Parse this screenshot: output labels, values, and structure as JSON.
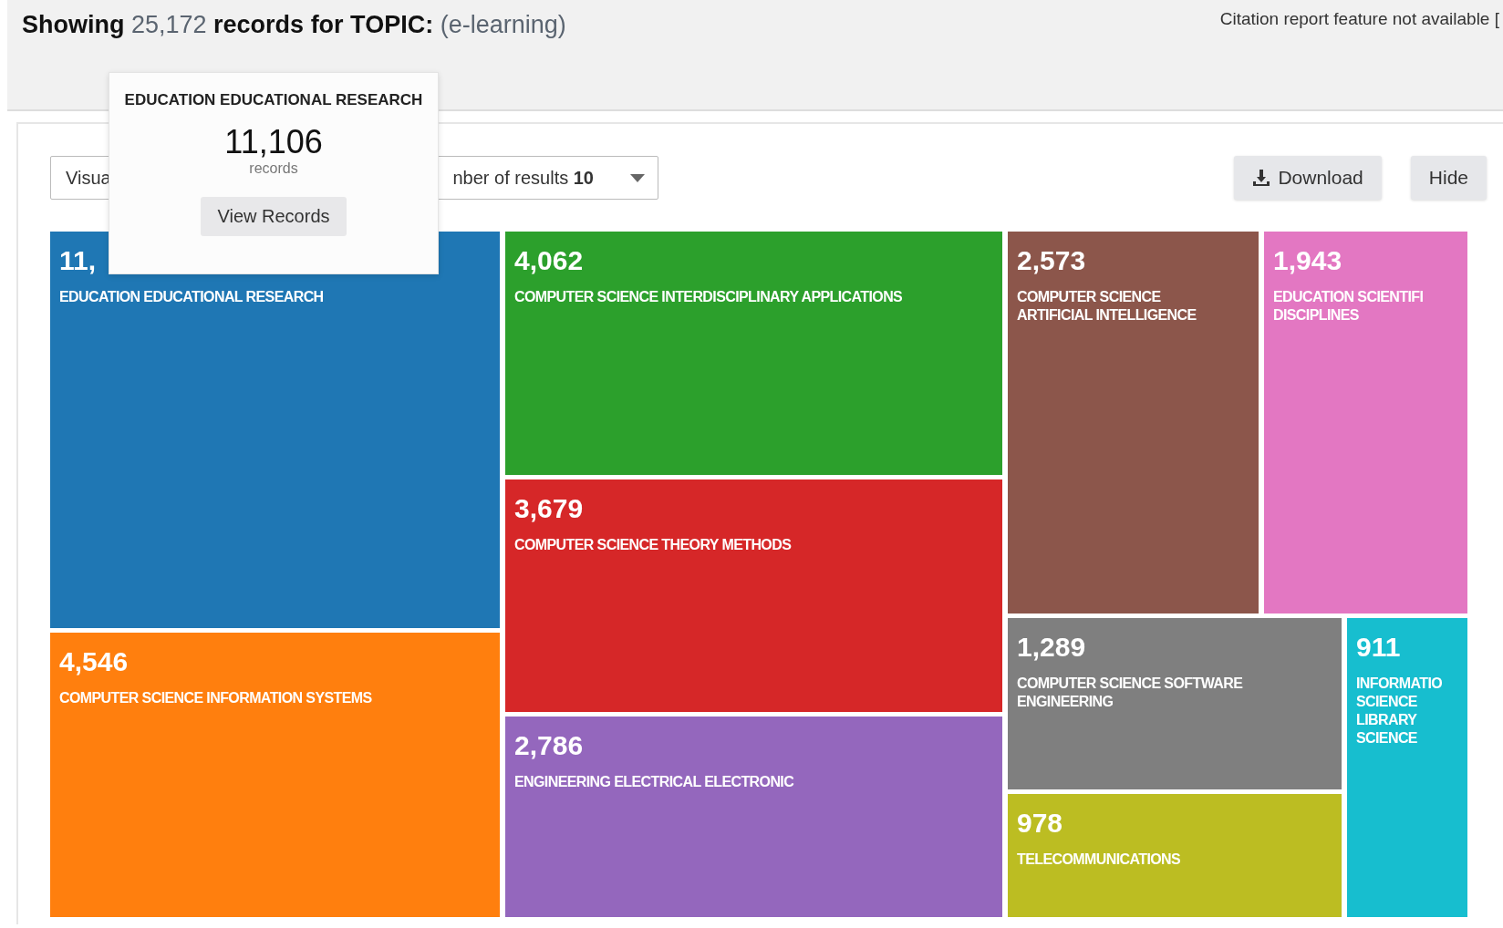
{
  "header": {
    "title": "**Showing** 25,172 **records for TOPIC:** (e-learning)",
    "notice": "Citation report feature not available ["
  },
  "toolbar": {
    "dropdown": {
      "left_text": "Visua",
      "right_text": "nber of results **10**"
    },
    "buttons": [
      {
        "label": "Download",
        "kind": "download"
      },
      {
        "label": "Hide",
        "kind": "plain"
      }
    ]
  },
  "tooltip": {
    "title": "EDUCATION EDUCATIONAL RESEARCH",
    "count": "11,106",
    "unit": "records",
    "button": "View Records"
  },
  "tiles": [
    {
      "value": "11,",
      "label_lines": [
        "EDUCATION EDUCATIONAL RESEARCH"
      ],
      "color": "#1f77b4"
    },
    {
      "value": "4,546",
      "label_lines": [
        "COMPUTER SCIENCE INFORMATION SYSTEMS"
      ],
      "color": "#ff7f0e"
    },
    {
      "value": "4,062",
      "label_lines": [
        "COMPUTER SCIENCE INTERDISCIPLINARY APPLICATIONS"
      ],
      "color": "#2ca02c"
    },
    {
      "value": "3,679",
      "label_lines": [
        "COMPUTER SCIENCE THEORY METHODS"
      ],
      "color": "#d62728"
    },
    {
      "value": "2,786",
      "label_lines": [
        "ENGINEERING ELECTRICAL ELECTRONIC"
      ],
      "color": "#9467bd"
    },
    {
      "value": "2,573",
      "label_lines": [
        "COMPUTER SCIENCE",
        "ARTIFICIAL INTELLIGENCE"
      ],
      "color": "#8c564b"
    },
    {
      "value": "1,943",
      "label_lines": [
        "EDUCATION SCIENTIFI",
        "DISCIPLINES"
      ],
      "color": "#e377c2"
    },
    {
      "value": "1,289",
      "label_lines": [
        "COMPUTER SCIENCE SOFTWARE",
        "ENGINEERING"
      ],
      "color": "#7f7f7f"
    },
    {
      "value": "978",
      "label_lines": [
        "TELECOMMUNICATIONS"
      ],
      "color": "#bcbd22"
    },
    {
      "value": "911",
      "label_lines": [
        "INFORMATIO",
        "SCIENCE",
        "LIBRARY",
        "SCIENCE"
      ],
      "color": "#17becf"
    }
  ]
}
